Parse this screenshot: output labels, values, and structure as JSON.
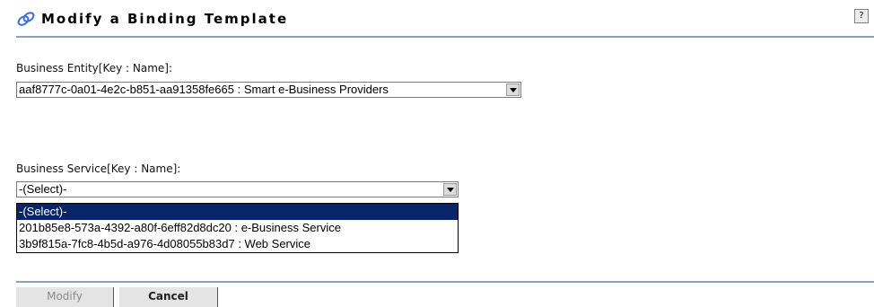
{
  "header": {
    "title": "Modify a Binding Template",
    "help_label": "?",
    "title_icon": "binding-template-icon"
  },
  "form": {
    "business_entity": {
      "label": "Business Entity[Key : Name]:",
      "value": "aaf8777c-0a01-4e2c-b851-aa91358fe665 : Smart e-Business Providers"
    },
    "business_service": {
      "label": "Business Service[Key : Name]:",
      "value": "-(Select)-",
      "options": [
        "-(Select)-",
        "201b85e8-573a-4392-a80f-6eff82d8dc20 : e-Business Service",
        "3b9f815a-7fc8-4b5d-a976-4d08055b83d7 : Web Service"
      ]
    }
  },
  "buttons": {
    "modify": "Modify",
    "cancel": "Cancel"
  },
  "colors": {
    "accent_rule": "#8fa1b8",
    "selection": "#0a246a",
    "icon": "#3b6fd1"
  }
}
